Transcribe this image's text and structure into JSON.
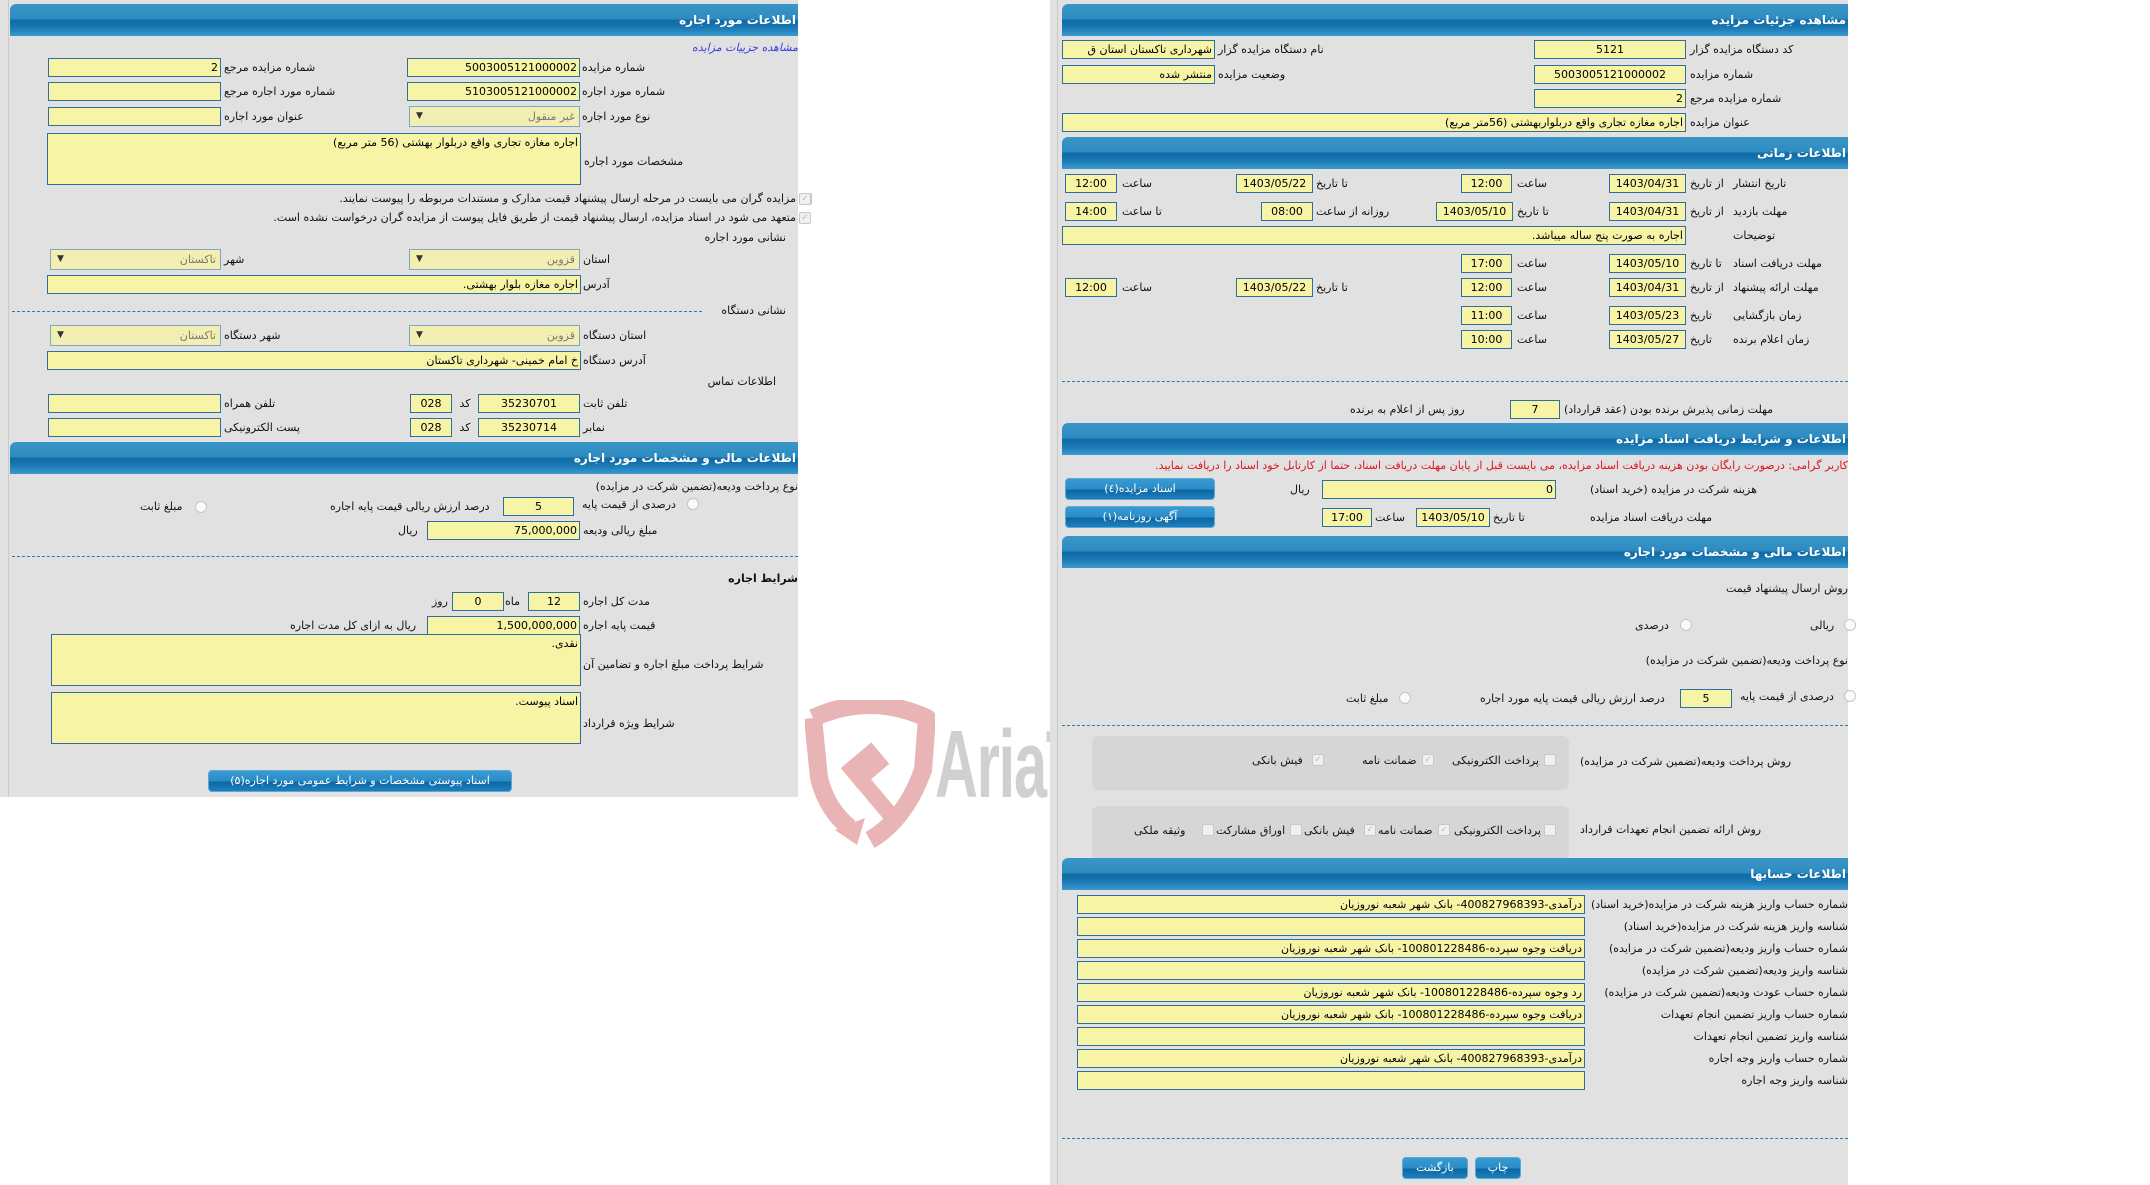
{
  "left_panel": {
    "header": "اطلاعات مورد اجاره",
    "view_auction_link": "مشاهده جزییات مزایده",
    "auction_number": {
      "label": "شماره مزایده",
      "value": "5003005121000002"
    },
    "ref_auction_number": {
      "label": "شماره مزایده مرجع",
      "value": "2"
    },
    "lease_item_number": {
      "label": "شماره مورد اجاره",
      "value": "5103005121000002"
    },
    "ref_lease_item_number": {
      "label": "شماره مورد اجاره مرجع",
      "value": ""
    },
    "lease_item_type": {
      "label": "نوع مورد اجاره",
      "value": "غیر منقول"
    },
    "lease_item_title": {
      "label": "عنوان مورد اجاره",
      "value": ""
    },
    "lease_item_spec": {
      "label": "مشخصات مورد اجاره",
      "value": "اجاره مغازه تجاری واقع دربلوار بهشتی (56 متر مربع)"
    },
    "checkbox_1": "مزایده گران می بایست در مرحله ارسال پیشنهاد قیمت مدارک و مستندات مربوطه را پیوست نمایند.",
    "checkbox_2": "متعهد می شود در اسناد مزایده، ارسال پیشنهاد قیمت از طریق فایل پیوست از مزایده گران درخواست نشده است.",
    "item_address_title": "نشانی مورد اجاره",
    "province": {
      "label": "استان",
      "value": "قزوین"
    },
    "city": {
      "label": "شهر",
      "value": "تاکستان"
    },
    "address": {
      "label": "آدرس",
      "value": "اجاره مغازه بلوار بهشتی."
    },
    "org_address_title": "نشانی دستگاه",
    "org_province": {
      "label": "استان دستگاه",
      "value": "قزوین"
    },
    "org_city": {
      "label": "شهر دستگاه",
      "value": "تاکستان"
    },
    "org_address": {
      "label": "آدرس دستگاه",
      "value": "خ امام خمینی- شهرداری تاکستان"
    },
    "contact_title": "اطلاعات تماس",
    "phone": {
      "label": "تلفن ثابت",
      "value": "35230701",
      "code_label": "کد",
      "code": "028"
    },
    "fax": {
      "label": "نمابر",
      "value": "35230714",
      "code_label": "کد",
      "code": "028"
    },
    "mobile": {
      "label": "تلفن همراه",
      "value": ""
    },
    "email": {
      "label": "پست الکترونیکی",
      "value": ""
    },
    "finance_header": "اطلاعات مالی و مشخصات مورد اجاره",
    "deposit_type_label": "نوع پرداخت ودیعه(تضمین شرکت در مزایده)",
    "percent_option": "درصدی از قیمت پایه",
    "percent_value": "5",
    "percent_suffix": "درصد ارزش ریالی قیمت پایه اجاره",
    "fixed_option": "مبلغ ثابت",
    "deposit_amount": {
      "label": "مبلغ ریالی ودیعه",
      "value": "75,000,000",
      "unit": "ریال"
    },
    "lease_terms_title": "شرایط اجاره",
    "duration": {
      "label": "مدت کل اجاره",
      "months": "12",
      "months_label": "ماه",
      "days": "0",
      "days_label": "روز"
    },
    "base_price": {
      "label": "قیمت پایه اجاره",
      "value": "1,500,000,000",
      "suffix": "ریال به ازای کل مدت اجاره"
    },
    "payment_terms": {
      "label": "شرایط پرداخت مبلغ اجاره و تضامین آن",
      "value": "نقدی."
    },
    "special_terms": {
      "label": "شرایط ویژه قرارداد",
      "value": "اسناد پیوست."
    },
    "attachments_button": "اسناد پیوستی مشخصات و شرایط عمومی مورد اجاره(۵)"
  },
  "right_panel": {
    "header": "مشاهده جزئیات مزایده",
    "org_code": {
      "label": "کد دستگاه مزایده گزار",
      "value": "5121"
    },
    "org_name": {
      "label": "نام دستگاه مزایده گزار",
      "value": "شهرداری تاکستان استان ق"
    },
    "auction_number": {
      "label": "شماره مزایده",
      "value": "5003005121000002"
    },
    "auction_status": {
      "label": "وضعیت مزایده",
      "value": "منتشر شده"
    },
    "ref_auction_number": {
      "label": "شماره مزایده مرجع",
      "value": "2"
    },
    "auction_title": {
      "label": "عنوان مزایده",
      "value": "اجاره مغازه تجاری واقع دربلواربهشتی (56متر مربع)"
    },
    "time_header": "اطلاعات زمانی",
    "labels": {
      "from_date": "از تاریخ",
      "to_date": "تا تاریخ",
      "date": "تاریخ",
      "hour": "ساعت",
      "to_hour": "تا ساعت",
      "daily_from_hour": "روزانه از ساعت"
    },
    "publish": {
      "label": "تاریخ انتشار",
      "from_date": "1403/04/31",
      "from_time": "12:00",
      "to_date": "1403/05/22",
      "to_time": "12:00"
    },
    "visit": {
      "label": "مهلت بازدید",
      "from_date": "1403/04/31",
      "to_date": "1403/05/10",
      "daily_from": "08:00",
      "to_time": "14:00"
    },
    "description": {
      "label": "توضیحات",
      "value": "اجاره به صورت پنج ساله میباشد."
    },
    "doc_deadline": {
      "label": "مهلت دریافت اسناد",
      "to_date": "1403/05/10",
      "time": "17:00"
    },
    "bid_deadline": {
      "label": "مهلت ارائه پیشنهاد",
      "from_date": "1403/04/31",
      "from_time": "12:00",
      "to_date": "1403/05/22",
      "to_time": "12:00"
    },
    "opening": {
      "label": "زمان بازگشایی",
      "date": "1403/05/23",
      "time": "11:00"
    },
    "winner": {
      "label": "زمان اعلام برنده",
      "date": "1403/05/27",
      "time": "10:00"
    },
    "acceptance": {
      "label": "مهلت زمانی پذیرش برنده بودن (عقد قرارداد)",
      "value": "7",
      "suffix": "روز پس از اعلام به برنده"
    },
    "docs_header": "اطلاعات و شرایط دریافت اسناد مزایده",
    "notice": "کاربر گرامی: درصورت رایگان بودن هزینه دریافت اسناد مزایده، می بایست قبل از پایان مهلت دریافت اسناد، حتما از کارتابل خود اسناد را دریافت نمایید.",
    "fee": {
      "label": "هزینه شرکت در مزایده (خرید اسناد)",
      "value": "0",
      "unit": "ریال"
    },
    "docs_button": "اسناد مزایده(٤)",
    "doc_receive": {
      "label": "مهلت دریافت اسناد مزایده",
      "to_date_label": "تا تاریخ",
      "date": "1403/05/10",
      "hour_label": "ساعت",
      "time": "17:00"
    },
    "newspaper_button": "آگهی روزنامه(۱)",
    "finance_header": "اطلاعات مالی و مشخصات مورد اجاره",
    "bid_method_label": "روش ارسال پیشنهاد قیمت",
    "bid_method_options": [
      "ریالی",
      "درصدی"
    ],
    "deposit_type_label": "نوع پرداخت ودیعه(تضمین شرکت در مزایده)",
    "percent_option": "درصدی از قیمت پایه",
    "percent_value": "5",
    "percent_suffix": "درصد ارزش ریالی قیمت پایه مورد اجاره",
    "fixed_option": "مبلغ ثابت",
    "deposit_payment": {
      "label": "روش پرداخت ودیعه(تضمین شرکت در مزایده)",
      "options": [
        {
          "label": "پرداخت الکترونیکی",
          "checked": false
        },
        {
          "label": "ضمانت نامه",
          "checked": true
        },
        {
          "label": "فیش بانکی",
          "checked": true
        }
      ]
    },
    "guarantee_payment": {
      "label": "روش ارائه تضمین انجام تعهدات قرارداد",
      "options": [
        {
          "label": "پرداخت الکترونیکی",
          "checked": false
        },
        {
          "label": "ضمانت نامه",
          "checked": true
        },
        {
          "label": "فیش بانکی",
          "checked": true
        },
        {
          "label": "اوراق مشارکت",
          "checked": false
        },
        {
          "label": "وثیقه ملکی",
          "checked": false
        }
      ]
    },
    "accounts_header": "اطلاعات حسابها",
    "accounts": [
      {
        "label": "شماره حساب واریز هزینه شرکت در مزایده(خرید اسناد)",
        "value": "درآمدی-400827968393- بانک شهر شعبه نوروزیان"
      },
      {
        "label": "شناسه واریز هزینه شرکت در مزایده(خرید اسناد)",
        "value": ""
      },
      {
        "label": "شماره حساب واریز ودیعه(تضمین شرکت در مزایده)",
        "value": "دریافت وجوه سپرده-100801228486- بانک شهر شعبه نوروزیان"
      },
      {
        "label": "شناسه واریز ودیعه(تضمین شرکت در مزایده)",
        "value": ""
      },
      {
        "label": "شماره حساب عودت ودیعه(تضمین شرکت در مزایده)",
        "value": "رد وجوه سپرده-100801228486- بانک شهر شعبه نوروزیان"
      },
      {
        "label": "شماره حساب واریز تضمین انجام تعهدات",
        "value": "دریافت وجوه سپرده-100801228486- بانک شهر شعبه نوروزیان"
      },
      {
        "label": "شناسه واریز تضمین انجام تعهدات",
        "value": ""
      },
      {
        "label": "شماره حساب واریز وجه اجاره",
        "value": "درآمدی-400827968393- بانک شهر شعبه نوروزیان"
      },
      {
        "label": "شناسه واریز وجه اجاره",
        "value": ""
      }
    ],
    "print_button": "چاپ",
    "back_button": "بازگشت"
  },
  "watermark": {
    "text": "AriaTender.neT"
  },
  "colors": {
    "header_blue": "#1c7ab4",
    "input_yellow": "#f7f4a6",
    "panel_gray": "#e1e1e1",
    "notice_red": "#e0141b"
  }
}
